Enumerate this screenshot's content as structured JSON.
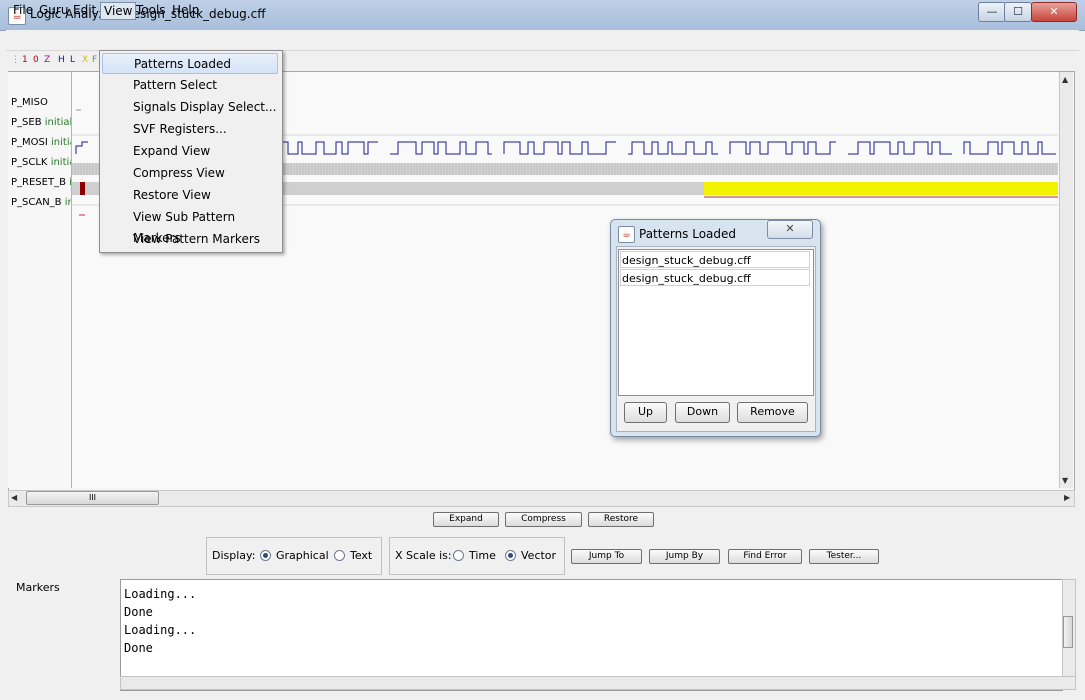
{
  "window": {
    "title": "Logic Analyzer: design_stuck_debug.cff",
    "app_icon": "java-cup-icon",
    "minimize": "—",
    "maximize": "☐",
    "close": "✕"
  },
  "menubar": [
    "File",
    "Guru",
    "Edit",
    "View",
    "Tools",
    "Help"
  ],
  "legend": [
    "1",
    "0",
    "Z",
    "H",
    "L",
    "X",
    "F"
  ],
  "legend_colors": [
    "#c00000",
    "#c00000",
    "#b000b0",
    "#1a1a9a",
    "#1a1a9a",
    "#d8c000",
    "#808080"
  ],
  "signals": [
    {
      "name": "P_MISO",
      "init": ""
    },
    {
      "name": "P_SEB",
      "init": "initial"
    },
    {
      "name": "P_MOSI",
      "init": "initia"
    },
    {
      "name": "P_SCLK",
      "init": "initia"
    },
    {
      "name": "P_RESET_B",
      "init": "i"
    },
    {
      "name": "P_SCAN_B",
      "init": "in"
    }
  ],
  "view_menu": [
    "Patterns Loaded",
    "Pattern Select",
    "Signals Display Select...",
    "SVF Registers...",
    "Expand View",
    "Compress View",
    "Restore View",
    "View Sub Pattern Markers",
    "View Pattern Markers"
  ],
  "view_menu_selected": 0,
  "scroll": {
    "h_thumb": "III",
    "left_arrow": "◀",
    "right_arrow": "▶",
    "up_arrow": "▲",
    "down_arrow": "▼"
  },
  "zoom_buttons": [
    "Expand",
    "Compress",
    "Restore"
  ],
  "display": {
    "label": "Display:",
    "options": [
      "Graphical",
      "Text"
    ],
    "selected": 0
  },
  "xscale": {
    "label": "X Scale is:",
    "options": [
      "Time",
      "Vector"
    ],
    "selected": 1
  },
  "action_buttons": [
    "Jump To",
    "Jump By",
    "Find Error",
    "Tester..."
  ],
  "markers_label": "Markers",
  "log": [
    "Loading...",
    "Done",
    "Loading...",
    "Done"
  ],
  "dialog": {
    "title": "Patterns Loaded",
    "close": "✕",
    "items": [
      "design_stuck_debug.cff",
      "design_stuck_debug.cff"
    ],
    "buttons": [
      "Up",
      "Down",
      "Remove"
    ]
  }
}
